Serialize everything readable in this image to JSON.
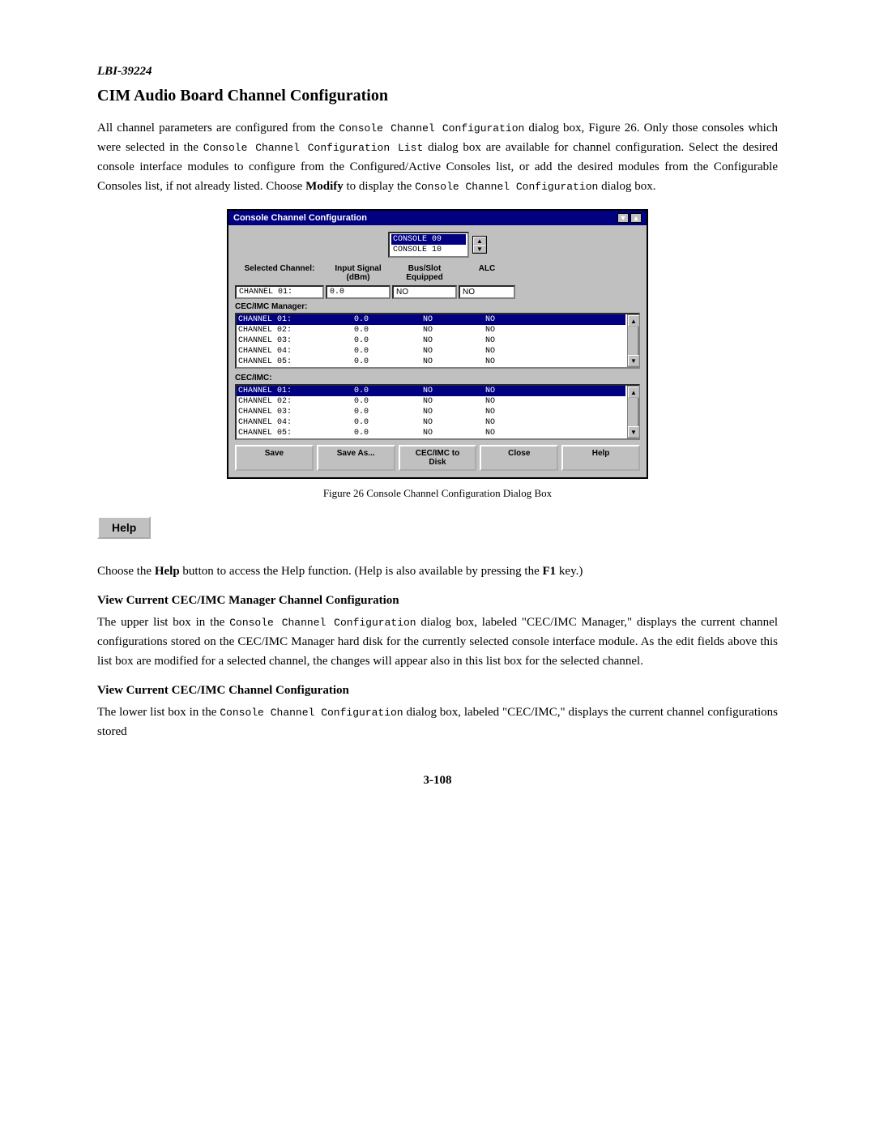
{
  "doc": {
    "id": "LBI-39224",
    "section_title": "CIM Audio Board Channel Configuration",
    "paragraph1": "All channel parameters are configured from the Console Channel Configuration dialog box, Figure 26. Only those consoles which were selected in the Console Channel Configuration List dialog box are available for channel configuration. Select the desired console interface modules to configure from the Configured/Active Consoles list, or add the desired modules from the Configurable Consoles list, if not already listed. Choose Modify to display the Console Channel Configuration dialog box.",
    "figure_caption": "Figure 26  Console Channel Configuration Dialog Box",
    "help_paragraph": "Choose the Help button to access the Help function. (Help is also available by pressing the F1 key.)",
    "subsection1_title": "View Current CEC/IMC Manager Channel Configuration",
    "subsection1_body": "The upper list box in the Console Channel Configuration dialog box, labeled \"CEC/IMC Manager,\" displays the current channel configurations stored on the CEC/IMC Manager hard disk for the currently selected console interface module. As the edit fields above this list box are modified for a selected channel, the changes will appear also in this list box for the selected channel.",
    "subsection2_title": "View Current CEC/IMC Channel Configuration",
    "subsection2_body": "The lower list box in the Console Channel Configuration dialog box, labeled \"CEC/IMC,\" displays the current channel configurations stored",
    "page_number": "3-108"
  },
  "dialog": {
    "title": "Console Channel Configuration",
    "minimize_btn": "▼",
    "maximize_btn": "▲",
    "consoles": [
      "CONSOLE 09",
      "CONSOLE 10"
    ],
    "selected_console": 0,
    "headers": {
      "col1": "Selected Channel:",
      "col2": "Input Signal\n(dBm)",
      "col3": "Bus/Slot\nEquipped",
      "col4": "ALC"
    },
    "selected_channel": "CHANNEL 01:",
    "input_signal": "0.0",
    "bus_slot": "NO",
    "alc": "NO",
    "cec_imc_manager_label": "CEC/IMC Manager:",
    "cec_imc_manager_rows": [
      {
        "channel": "CHANNEL 01:",
        "input": "0.0",
        "bus_slot": "NO",
        "alc": "NO",
        "selected": true
      },
      {
        "channel": "CHANNEL 02:",
        "input": "0.0",
        "bus_slot": "NO",
        "alc": "NO",
        "selected": false
      },
      {
        "channel": "CHANNEL 03:",
        "input": "0.0",
        "bus_slot": "NO",
        "alc": "NO",
        "selected": false
      },
      {
        "channel": "CHANNEL 04:",
        "input": "0.0",
        "bus_slot": "NO",
        "alc": "NO",
        "selected": false
      },
      {
        "channel": "CHANNEL 05:",
        "input": "0.0",
        "bus_slot": "NO",
        "alc": "NO",
        "selected": false
      }
    ],
    "cec_imc_label": "CEC/IMC:",
    "cec_imc_rows": [
      {
        "channel": "CHANNEL 01:",
        "input": "0.0",
        "bus_slot": "NO",
        "alc": "NO",
        "selected": true
      },
      {
        "channel": "CHANNEL 02:",
        "input": "0.0",
        "bus_slot": "NO",
        "alc": "NO",
        "selected": false
      },
      {
        "channel": "CHANNEL 03:",
        "input": "0.0",
        "bus_slot": "NO",
        "alc": "NO",
        "selected": false
      },
      {
        "channel": "CHANNEL 04:",
        "input": "0.0",
        "bus_slot": "NO",
        "alc": "NO",
        "selected": false
      },
      {
        "channel": "CHANNEL 05:",
        "input": "0.0",
        "bus_slot": "NO",
        "alc": "NO",
        "selected": false
      }
    ],
    "buttons": [
      "Save",
      "Save As...",
      "CEC/IMC to Disk",
      "Close",
      "Help"
    ]
  },
  "help_button_label": "Help"
}
